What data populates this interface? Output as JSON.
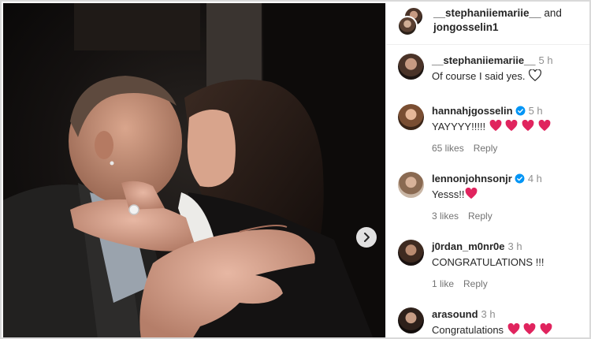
{
  "post": {
    "header": {
      "user1": "__stephaniiemariie__",
      "conjunction": "and",
      "user2": "jongosselin1"
    }
  },
  "comments": [
    {
      "username": "__stephaniiemariie__",
      "time": "5 h",
      "text": "Of course I said yes.",
      "verified": false,
      "likes": "",
      "reply": "",
      "emoji": "white-heart-icon"
    },
    {
      "username": "hannahjgosselin",
      "time": "5 h",
      "text": "YAYYYY!!!!!",
      "verified": true,
      "likes": "65 likes",
      "reply": "Reply",
      "emoji": "red-heart-icon x4"
    },
    {
      "username": "lennonjohnsonjr",
      "time": "4 h",
      "text": "Yesss!!",
      "verified": true,
      "likes": "3 likes",
      "reply": "Reply",
      "emoji": "red-heart-icon x1"
    },
    {
      "username": "j0rdan_m0nr0e",
      "time": "3 h",
      "text": "CONGRATULATIONS !!!",
      "verified": false,
      "likes": "1 like",
      "reply": "Reply",
      "emoji": ""
    },
    {
      "username": "arasound",
      "time": "3 h",
      "text": "Congratulations",
      "verified": false,
      "likes": "",
      "reply": "",
      "emoji": "red-heart-icon x3"
    }
  ],
  "colors": {
    "verified": "#0095f6",
    "heart": "#e0245e",
    "muted": "#8e8e8e"
  }
}
